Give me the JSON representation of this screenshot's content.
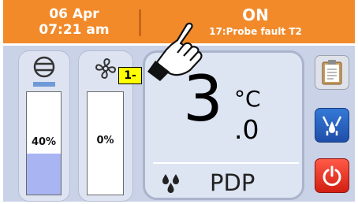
{
  "header": {
    "date": "06 Apr",
    "time": "07:21 am",
    "state": "ON",
    "alarm": "17:Probe fault T2"
  },
  "compressor": {
    "percent": 40,
    "label": "40%",
    "icon": "compressor-icon"
  },
  "fan": {
    "percent": 0,
    "label": "0%",
    "icon": "fan-icon"
  },
  "display": {
    "value_int": "3",
    "unit": "°C",
    "value_dec": ".0",
    "mode": "PDP",
    "mode_icon": "drops-icon"
  },
  "side_buttons": [
    {
      "icon": "clipboard-icon"
    },
    {
      "icon": "defrost-icon"
    },
    {
      "icon": "power-icon"
    }
  ],
  "callout": {
    "label": "1-"
  },
  "colors": {
    "header": "#f28a2a",
    "bar_fill": "#a9b5f2",
    "panel": "#c9d2e6",
    "power": "#e8321f",
    "defrost": "#2a62c0"
  }
}
